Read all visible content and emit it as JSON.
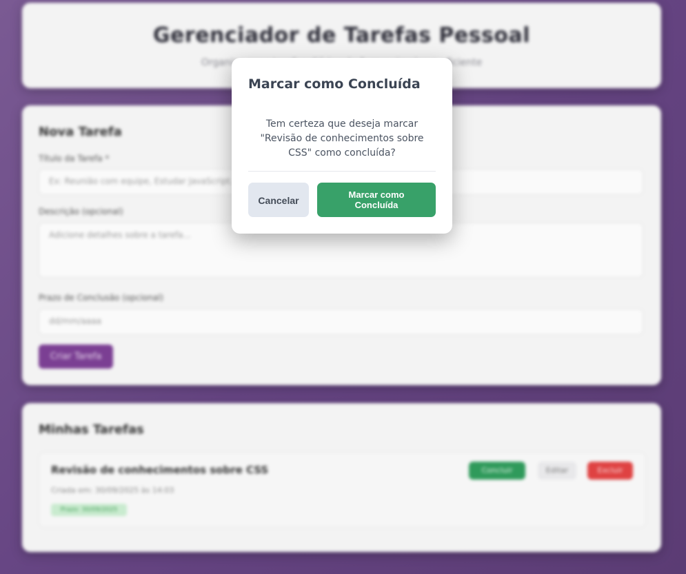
{
  "header": {
    "title": "Gerenciador de Tarefas Pessoal",
    "subtitle": "Organize suas tarefas diárias de forma simples e eficiente"
  },
  "form": {
    "section_title": "Nova Tarefa",
    "title_label": "Título da Tarefa *",
    "title_placeholder": "Ex: Reunião com equipe, Estudar JavaScript...",
    "description_label": "Descrição (opcional)",
    "description_placeholder": "Adicione detalhes sobre a tarefa...",
    "deadline_label": "Prazo de Conclusão (opcional)",
    "deadline_placeholder": "dd/mm/aaaa",
    "create_button": "Criar Tarefa"
  },
  "tasks": {
    "section_title": "Minhas Tarefas",
    "items": [
      {
        "title": "Revisão de conhecimentos sobre CSS",
        "created": "Criada em: 30/09/2025 às 14:03",
        "deadline": "Prazo: 30/09/2025",
        "complete_label": "Concluir",
        "edit_label": "Editar",
        "delete_label": "Excluir"
      }
    ]
  },
  "modal": {
    "title": "Marcar como Concluída",
    "message": "Tem certeza que deseja marcar \"Revisão de conhecimentos sobre CSS\" como concluída?",
    "cancel_label": "Cancelar",
    "confirm_label": "Marcar como Concluída"
  },
  "colors": {
    "confirm": "#38a169",
    "cancel_bg": "#e2e7ef",
    "background": "#654482"
  }
}
